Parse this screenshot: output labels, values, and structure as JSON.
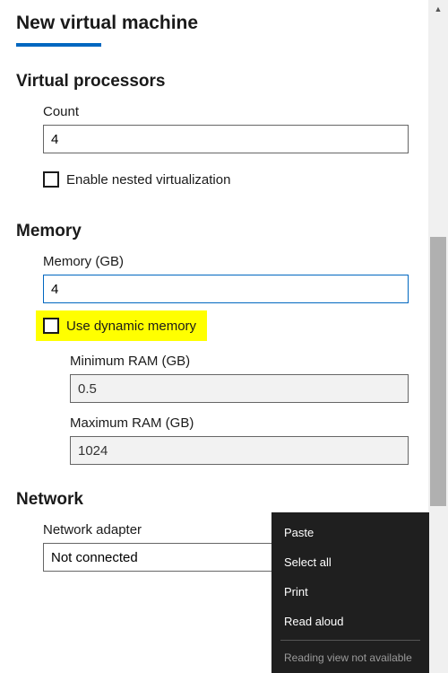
{
  "title": "New virtual machine",
  "sections": {
    "vproc": {
      "heading": "Virtual processors",
      "count_label": "Count",
      "count_value": "4",
      "nested_label": "Enable nested virtualization"
    },
    "memory": {
      "heading": "Memory",
      "memory_label": "Memory (GB)",
      "memory_value": "4",
      "dynamic_label": "Use dynamic memory",
      "min_label": "Minimum RAM (GB)",
      "min_value": "0.5",
      "max_label": "Maximum RAM (GB)",
      "max_value": "1024"
    },
    "network": {
      "heading": "Network",
      "adapter_label": "Network adapter",
      "adapter_value": "Not connected"
    }
  },
  "context_menu": {
    "paste": "Paste",
    "select_all": "Select all",
    "print": "Print",
    "read_aloud": "Read aloud",
    "reading_view": "Reading view not available"
  }
}
